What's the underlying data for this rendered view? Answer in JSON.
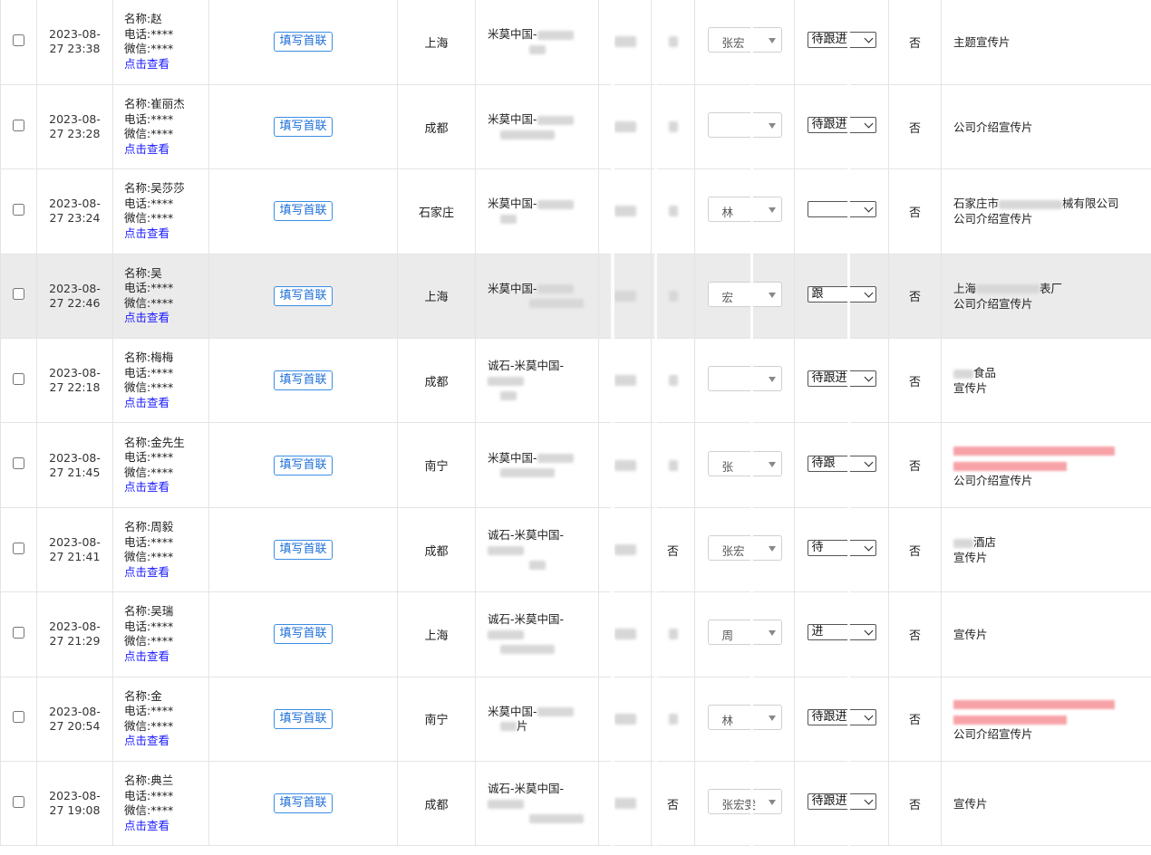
{
  "labels": {
    "name_prefix": "名称:",
    "phone_prefix": "电话:",
    "wechat_prefix": "微信:",
    "view_link": "点击查看",
    "fill_button": "填写首联"
  },
  "rows": [
    {
      "date": "2023-08-",
      "time": "27 23:38",
      "name": "赵",
      "phone": "****",
      "wechat": "****",
      "city": "上海",
      "product": "米莫中国-",
      "product_l2": "",
      "agent": "张宏",
      "status": "待跟进",
      "flag": "否",
      "remark_l1": "主题宣传片",
      "remark_l2": ""
    },
    {
      "date": "2023-08-",
      "time": "27 23:28",
      "name": "崔丽杰",
      "phone": "****",
      "wechat": "****",
      "city": "成都",
      "product": "米莫中国-",
      "product_l2": "",
      "agent": "",
      "status": "待跟进",
      "flag": "否",
      "remark_l1": "公司介绍宣传片",
      "remark_l2": ""
    },
    {
      "date": "2023-08-",
      "time": "27 23:24",
      "name": "吴莎莎",
      "phone": "****",
      "wechat": "****",
      "city": "石家庄",
      "product": "米莫中国-",
      "product_l2": "",
      "agent": "林",
      "status": "",
      "flag": "否",
      "remark_l1": "石家庄市",
      "remark_l1b": "械有限公司",
      "remark_l2": "公司介绍宣传片"
    },
    {
      "date": "2023-08-",
      "time": "27 22:46",
      "name": "吴",
      "phone": "****",
      "wechat": "****",
      "city": "上海",
      "product": "米莫中国-",
      "product_l2": "",
      "agent": "宏",
      "status": "跟",
      "flag": "否",
      "remark_l1": "上海",
      "remark_l1b": "表厂",
      "remark_l2": "公司介绍宣传片"
    },
    {
      "date": "2023-08-",
      "time": "27 22:18",
      "name": "梅梅",
      "phone": "****",
      "wechat": "****",
      "city": "成都",
      "product": "诚石-米莫中国-",
      "product_l2": "",
      "agent": "",
      "status": "待跟进",
      "flag": "否",
      "remark_l1": "食品",
      "remark_l2": "宣传片"
    },
    {
      "date": "2023-08-",
      "time": "27 21:45",
      "name": "金先生",
      "phone": "****",
      "wechat": "****",
      "city": "南宁",
      "product": "米莫中国-",
      "product_l2": "",
      "agent": "张",
      "status": "待跟",
      "flag": "否",
      "remark_l1": "",
      "remark_l2": "公司介绍宣传片"
    },
    {
      "date": "2023-08-",
      "time": "27 21:41",
      "name": "周毅",
      "phone": "****",
      "wechat": "****",
      "city": "成都",
      "product": "诚石-米莫中国-",
      "product_l2": "",
      "agent": "张宏",
      "status": "待",
      "flag": "否",
      "remark_l1": "酒店",
      "remark_l2": "宣传片"
    },
    {
      "date": "2023-08-",
      "time": "27 21:29",
      "name": "吴瑞",
      "phone": "****",
      "wechat": "****",
      "city": "上海",
      "product": "诚石-米莫中国-",
      "product_l2": "",
      "agent": "周",
      "status": "进",
      "flag": "否",
      "remark_l1": "宣传片",
      "remark_l2": ""
    },
    {
      "date": "2023-08-",
      "time": "27 20:54",
      "name": "金",
      "phone": "****",
      "wechat": "****",
      "city": "南宁",
      "product": "米莫中国-",
      "product_l2": "片",
      "agent": "林",
      "status": "待跟进",
      "flag": "否",
      "remark_l1": "",
      "remark_l2": "公司介绍宣传片"
    },
    {
      "date": "2023-08-",
      "time": "27 19:08",
      "name": "典兰",
      "phone": "****",
      "wechat": "****",
      "city": "成都",
      "product": "诚石-米莫中国-",
      "product_l2": "",
      "agent": "张宏雯",
      "status": "待跟进",
      "flag": "否",
      "remark_l1": "宣传片",
      "remark_l2": ""
    }
  ],
  "hidden_col_values": [
    "否",
    "否",
    "否"
  ]
}
